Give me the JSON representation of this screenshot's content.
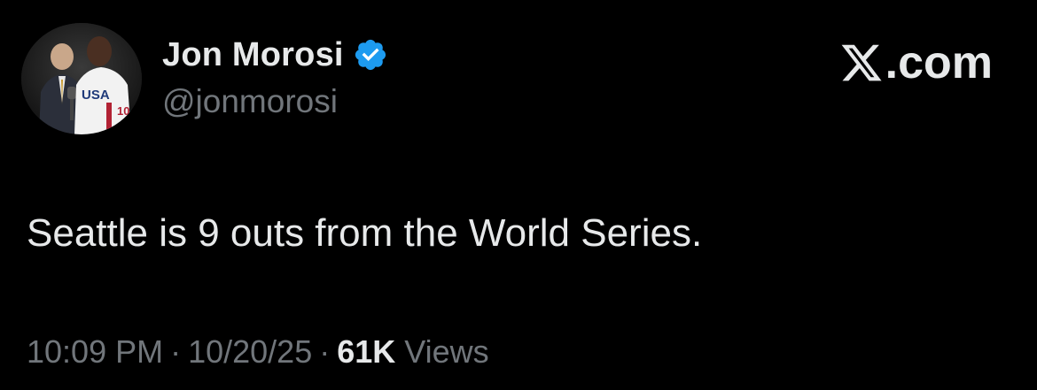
{
  "author": {
    "display_name": "Jon Morosi",
    "handle": "@jonmorosi",
    "verified_color": "#1d9bf0"
  },
  "brand": {
    "text": ".com",
    "icon": "x-logo-icon"
  },
  "tweet": {
    "text": "Seattle is 9 outs from the World Series."
  },
  "meta": {
    "time": "10:09 PM",
    "separator": "·",
    "date": "10/20/25",
    "views_count": "61K",
    "views_label": "Views"
  },
  "colors": {
    "background": "#000000",
    "primary_text": "#e7e9ea",
    "secondary_text": "#71767b"
  }
}
